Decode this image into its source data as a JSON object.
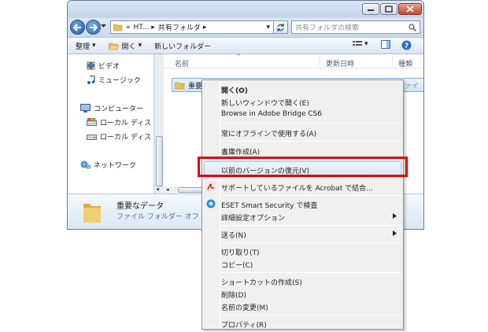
{
  "window": {
    "address": {
      "overflow": "«",
      "segment1": "HT...",
      "segment2": "共有フォルダ"
    },
    "search_placeholder": "共有フォルダの検索"
  },
  "toolbar": {
    "organize_label": "整理",
    "open_label": "開く",
    "new_folder_label": "新しいフォルダー"
  },
  "nav_pane": {
    "items": [
      {
        "label": "ビデオ",
        "icon": "video-icon"
      },
      {
        "label": "ミュージック",
        "icon": "music-icon"
      },
      {
        "label": "コンピューター",
        "icon": "computer-icon"
      },
      {
        "label": "ローカル ディス",
        "icon": "drive-icon"
      },
      {
        "label": "ローカル ディス",
        "icon": "drive-icon"
      },
      {
        "label": "ネットワーク",
        "icon": "network-icon"
      }
    ]
  },
  "file_list": {
    "columns": {
      "name": "名前",
      "modified": "更新日時",
      "type": "種類"
    },
    "rows": [
      {
        "name": "重要な",
        "type": "ファイ"
      }
    ]
  },
  "details_pane": {
    "name": "重要なデータ",
    "type": "ファイル フォルダー  オフ"
  },
  "context_menu": {
    "items": [
      {
        "label": "開く(O)",
        "bold": true
      },
      {
        "label": "新しいウィンドウで開く(E)"
      },
      {
        "label": "Browse in Adobe Bridge CS6"
      },
      {
        "label": "常にオフラインで使用する(A)"
      },
      {
        "label": "書庫作成(A)"
      },
      {
        "label": "以前のバージョンの復元(V)",
        "highlighted": true
      },
      {
        "label": "サポートしているファイルを Acrobat で結合..."
      },
      {
        "label": "ESET Smart Security で検査"
      },
      {
        "label": "詳細設定オプション",
        "submenu": true
      },
      {
        "label": "送る(N)",
        "submenu": true
      },
      {
        "label": "切り取り(T)"
      },
      {
        "label": "コピー(C)"
      },
      {
        "label": "ショートカットの作成(S)"
      },
      {
        "label": "削除(D)"
      },
      {
        "label": "名前の変更(M)"
      },
      {
        "label": "プロパティ(R)"
      }
    ]
  },
  "colors": {
    "highlight_box": "#e10000",
    "menu_background": "#f0f0f0",
    "window_frame": "#c9daee"
  }
}
